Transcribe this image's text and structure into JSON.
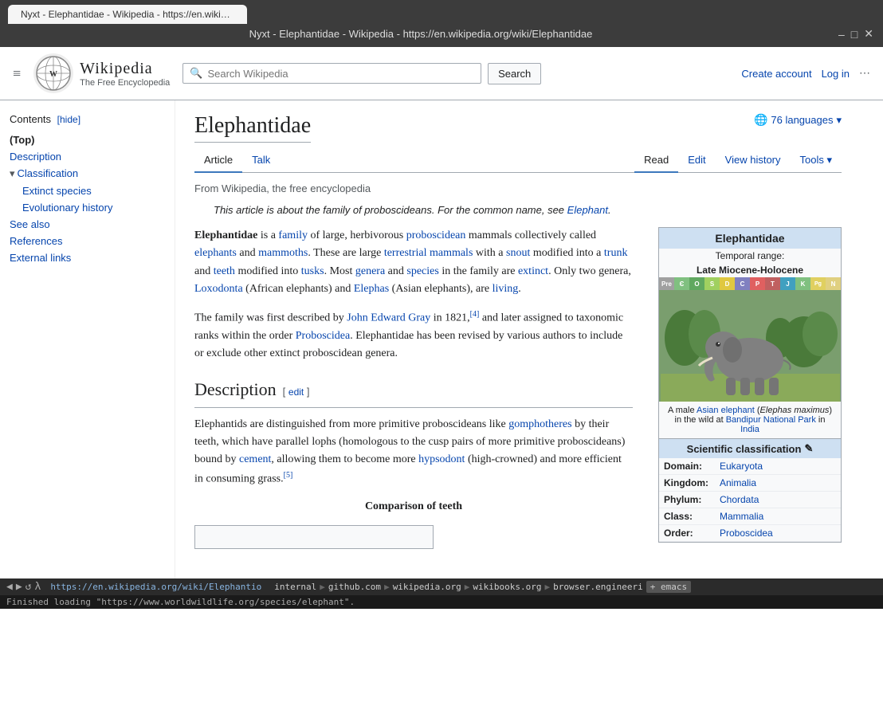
{
  "browser": {
    "tab_title": "Nyxt - Elephantidae - Wikipedia - https://en.wikipedia.org/wiki/Elephantidae",
    "url": "https://en.wikipedia.org/wiki/Elephantio",
    "controls": {
      "minimize": "–",
      "maximize": "□",
      "close": "✕"
    },
    "breadcrumbs": [
      "internal",
      "github.com",
      "wikipedia.org",
      "wikibooks.org",
      "browser.engineeri"
    ],
    "breadcrumb_add": "+ emacs",
    "status_text": "Finished loading \"https://www.worldwildlife.org/species/elephant\"."
  },
  "header": {
    "logo_emoji": "🌐",
    "logo_title": "Wikipedia",
    "logo_subtitle": "The Free Encyclopedia",
    "search_placeholder": "Search Wikipedia",
    "search_button": "Search",
    "create_account": "Create account",
    "log_in": "Log in",
    "more_icon": "⋯",
    "hamburger": "≡"
  },
  "toc": {
    "header": "Contents",
    "hide_label": "[hide]",
    "items": [
      {
        "label": "(Top)",
        "active": true,
        "indent": 0
      },
      {
        "label": "Description",
        "active": false,
        "indent": 0
      },
      {
        "label": "Classification",
        "active": false,
        "indent": 0,
        "expandable": true
      },
      {
        "label": "Extinct species",
        "active": false,
        "indent": 1
      },
      {
        "label": "Evolutionary history",
        "active": false,
        "indent": 1
      },
      {
        "label": "See also",
        "active": false,
        "indent": 0
      },
      {
        "label": "References",
        "active": false,
        "indent": 0
      },
      {
        "label": "External links",
        "active": false,
        "indent": 0
      }
    ]
  },
  "article": {
    "title": "Elephantidae",
    "langs_count": "76 languages",
    "from_text": "From Wikipedia, the free encyclopedia",
    "italic_note": "This article is about the family of proboscideans. For the common name, see ",
    "italic_note_link": "Elephant",
    "italic_note_end": ".",
    "tabs": [
      {
        "label": "Article",
        "active": true
      },
      {
        "label": "Talk",
        "active": false
      }
    ],
    "tabs_right": [
      {
        "label": "Read",
        "active": true
      },
      {
        "label": "Edit",
        "active": false
      },
      {
        "label": "View history",
        "active": false
      },
      {
        "label": "Tools ▾",
        "active": false
      }
    ],
    "paragraphs": [
      "Elephantidae is a family of large, herbivorous proboscidean mammals collectively called elephants and mammoths. These are large terrestrial mammals with a snout modified into a trunk and teeth modified into tusks. Most genera and species in the family are extinct. Only two genera, Loxodonta (African elephants) and Elephas (Asian elephants), are living.",
      "The family was first described by John Edward Gray in 1821,[4] and later assigned to taxonomic ranks within the order Proboscidea. Elephantidae has been revised by various authors to include or exclude other extinct proboscidean genera."
    ],
    "description_heading": "Description",
    "description_edit": "edit",
    "description_para": "Elephantids are distinguished from more primitive proboscideans like gomphotheres by their teeth, which have parallel lophs (homologous to the cusp pairs of more primitive proboscideans) bound by cement, allowing them to become more hypsodont (high-crowned) and more efficient in consuming grass.[5]",
    "comparison_title": "Comparison of teeth",
    "infobox": {
      "title": "Elephantidae",
      "temporal_label": "Temporal range:",
      "temporal_range": "Late Miocene-Holocene",
      "timebar": [
        {
          "label": "Pre",
          "color": "#a0a0a0"
        },
        {
          "label": "Є",
          "color": "#80c080"
        },
        {
          "label": "O",
          "color": "#60a860"
        },
        {
          "label": "S",
          "color": "#a0d060"
        },
        {
          "label": "D",
          "color": "#e0c840"
        },
        {
          "label": "C",
          "color": "#8080c0"
        },
        {
          "label": "P",
          "color": "#e06060"
        },
        {
          "label": "T",
          "color": "#c06060"
        },
        {
          "label": "J",
          "color": "#40a0c0"
        },
        {
          "label": "K",
          "color": "#80c080"
        },
        {
          "label": "Pg",
          "color": "#e0d060"
        },
        {
          "label": "N",
          "color": "#e0d080"
        }
      ],
      "caption": "A male Asian elephant (Elephas maximus) in the wild at Bandipur National Park in India",
      "caption_links": [
        "Asian elephant",
        "Bandipur National Park",
        "India"
      ],
      "sci_class_label": "Scientific classification",
      "rows": [
        {
          "label": "Domain:",
          "value": "Eukaryota",
          "link": true
        },
        {
          "label": "Kingdom:",
          "value": "Animalia",
          "link": true
        },
        {
          "label": "Phylum:",
          "value": "Chordata",
          "link": true
        },
        {
          "label": "Class:",
          "value": "Mammalia",
          "link": true
        },
        {
          "label": "Order:",
          "value": "Proboscidea",
          "link": true
        }
      ]
    }
  }
}
